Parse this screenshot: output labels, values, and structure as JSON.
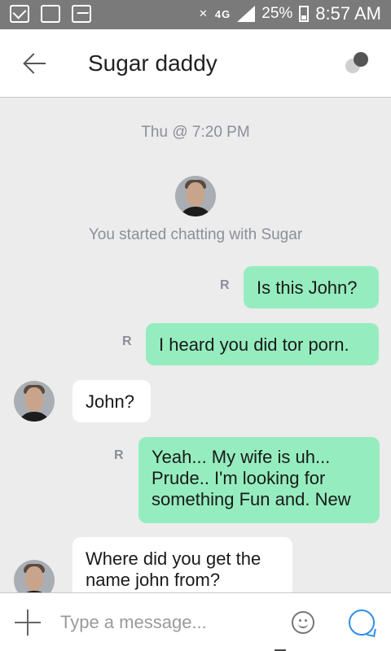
{
  "status_bar": {
    "network": "4G",
    "battery_percent": "25%",
    "time": "8:57 AM"
  },
  "header": {
    "title": "Sugar daddy"
  },
  "chat": {
    "date_stamp": "Thu @ 7:20 PM",
    "started_text": "You started chatting with Sugar",
    "receipt_glyph": "R",
    "messages": [
      {
        "direction": "out",
        "text": "Is this John?"
      },
      {
        "direction": "out",
        "text": "I heard you did tor porn."
      },
      {
        "direction": "in",
        "text": "John?"
      },
      {
        "direction": "out",
        "text": "Yeah... My wife is uh... Prude..  I'm looking for something Fun and. New"
      },
      {
        "direction": "in",
        "text": "Where did you get the name john from?"
      }
    ]
  },
  "composer": {
    "placeholder": "Type a message..."
  },
  "icons": {
    "back": "arrow-left-icon",
    "options": "toggle-dots-icon",
    "add": "plus-icon",
    "emoji": "smiley-icon",
    "send": "chat-bubble-icon"
  },
  "colors": {
    "outgoing_bubble": "#95edbf",
    "incoming_bubble": "#ffffff",
    "status_bar": "#7a7a7a",
    "send_accent": "#2e8ee8"
  }
}
